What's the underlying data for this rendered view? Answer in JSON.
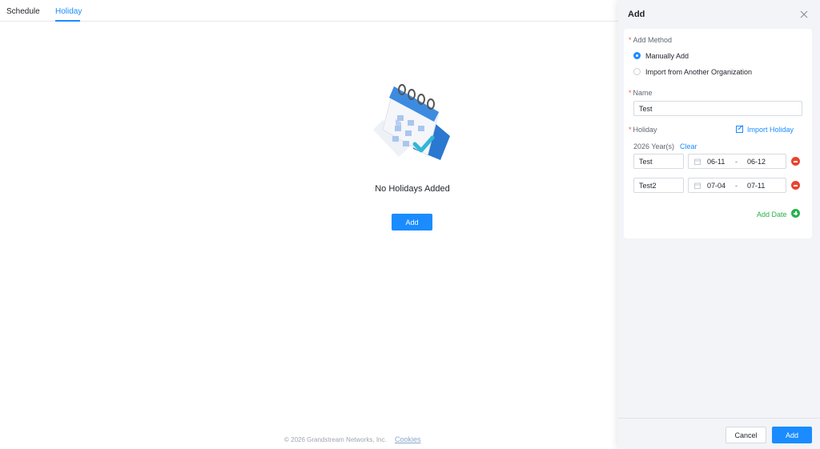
{
  "tabs": [
    {
      "label": "Schedule"
    },
    {
      "label": "Holiday"
    }
  ],
  "empty_state": {
    "message": "No Holidays Added",
    "add_label": "Add"
  },
  "footer": {
    "copyright": "© 2026 Grandstream Networks, Inc.",
    "cookies_label": "Cookies"
  },
  "drawer": {
    "title": "Add",
    "add_method_label": "Add Method",
    "methods": [
      {
        "label": "Manually Add",
        "selected": true
      },
      {
        "label": "Import from Another Organization",
        "selected": false
      }
    ],
    "name_label": "Name",
    "name_value": "Test",
    "holiday_label": "Holiday",
    "import_holiday_label": "Import Holiday",
    "year_label": "2026 Year(s)",
    "clear_label": "Clear",
    "holidays": [
      {
        "name": "Test",
        "start": "06-11",
        "end": "06-12"
      },
      {
        "name": "Test2",
        "start": "07-04",
        "end": "07-11"
      }
    ],
    "add_date_label": "Add Date",
    "cancel_label": "Cancel",
    "submit_label": "Add"
  },
  "colors": {
    "accent": "#1a8cff",
    "danger": "#e8452f",
    "success": "#27b24a",
    "required": "#f5573b"
  }
}
